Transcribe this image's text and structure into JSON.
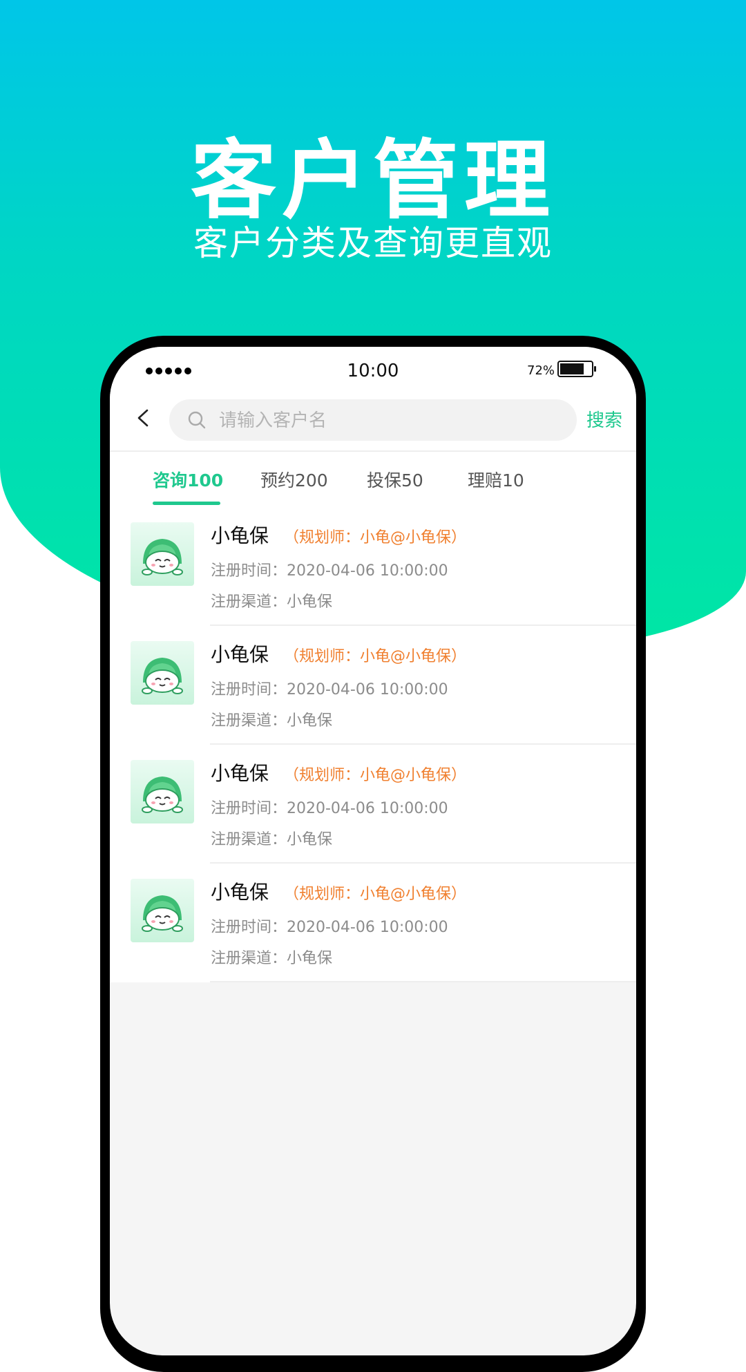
{
  "hero": {
    "title": "客户管理",
    "subtitle": "客户分类及查询更直观"
  },
  "status_bar": {
    "time": "10:00",
    "battery_percent": "72%"
  },
  "nav": {
    "search_placeholder": "请输入客户名",
    "search_button": "搜索"
  },
  "tabs": [
    {
      "label": "咨询100",
      "active": true
    },
    {
      "label": "预约200",
      "active": false
    },
    {
      "label": "投保50",
      "active": false
    },
    {
      "label": "理赔10",
      "active": false
    }
  ],
  "customers": [
    {
      "name": "小龟保",
      "planner": "（规划师：小龟@小龟保）",
      "reg_time": "注册时间：2020-04-06 10:00:00",
      "reg_channel": "注册渠道：小龟保"
    },
    {
      "name": "小龟保",
      "planner": "（规划师：小龟@小龟保）",
      "reg_time": "注册时间：2020-04-06 10:00:00",
      "reg_channel": "注册渠道：小龟保"
    },
    {
      "name": "小龟保",
      "planner": "（规划师：小龟@小龟保）",
      "reg_time": "注册时间：2020-04-06 10:00:00",
      "reg_channel": "注册渠道：小龟保"
    },
    {
      "name": "小龟保",
      "planner": "（规划师：小龟@小龟保）",
      "reg_time": "注册时间：2020-04-06 10:00:00",
      "reg_channel": "注册渠道：小龟保"
    }
  ],
  "colors": {
    "accent": "#1fc88e",
    "planner": "#f08030",
    "gradient_top": "#00c6e8",
    "gradient_bottom": "#00e6a4"
  },
  "icons": [
    "back-icon",
    "search-icon",
    "turtle-avatar-icon",
    "signal-icon",
    "battery-icon"
  ]
}
